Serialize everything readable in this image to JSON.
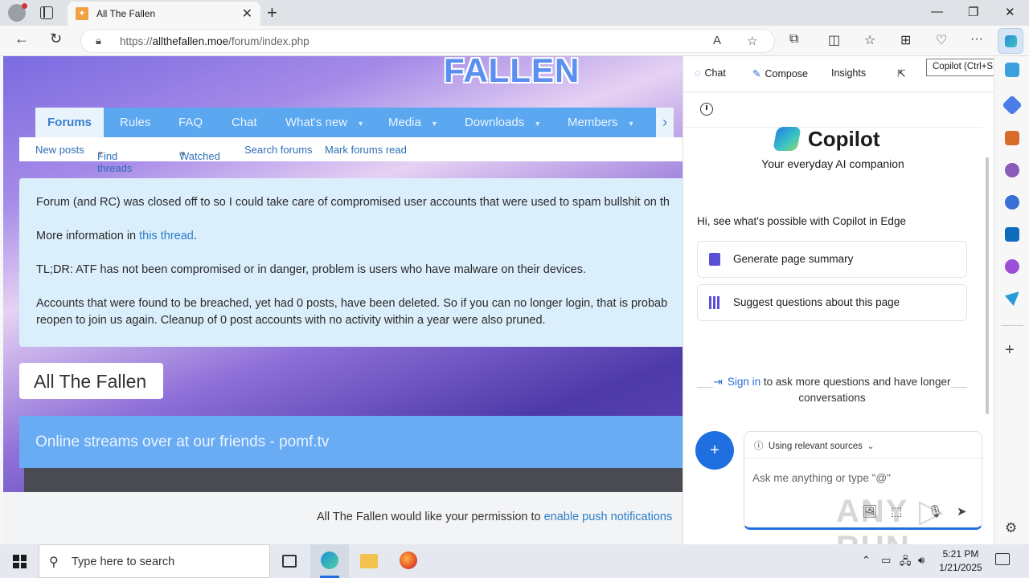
{
  "browser": {
    "tab_title": "All The Fallen",
    "new_tab": "+",
    "url_prefix": "https://",
    "url_domain": "allthefallen.moe",
    "url_path": "/forum/index.php",
    "tooltip": "Copilot (Ctrl+Shift+.)"
  },
  "site": {
    "logo_text": "FALLEN",
    "nav_tabs": [
      "Forums",
      "Rules",
      "FAQ",
      "Chat",
      "What's new",
      "Media",
      "Downloads",
      "Members"
    ],
    "sub_nav": [
      "New posts",
      "Find threads",
      "Watched",
      "Search forums",
      "Mark forums read"
    ],
    "notice": {
      "p1": "Forum (and RC) was closed off to so I could take care of compromised user accounts that were used to spam bullshit on th",
      "p2_before": "More information in ",
      "p2_link": "this thread",
      "p2_after": ".",
      "p3": "TL;DR: ATF has not been compromised or in danger, problem is users who have malware on their devices.",
      "p4_line1": "Accounts that were found to be breached, yet had 0 posts, have been deleted. So if you can no longer login, that is probab",
      "p4_line2": "reopen to join us again. Cleanup of 0 post accounts with no activity within a year were also pruned."
    },
    "forum_title": "All The Fallen",
    "stream_banner": "Online streams over at our friends - pomf.tv",
    "push_text": "All The Fallen would like your permission to ",
    "push_link": "enable push notifications"
  },
  "copilot": {
    "tabs": [
      "Chat",
      "Compose",
      "Insights"
    ],
    "brand": "Copilot",
    "tagline": "Your everyday AI companion",
    "intro": "Hi, see what's possible with Copilot in Edge",
    "cards": [
      "Generate page summary",
      "Suggest questions about this page"
    ],
    "signin_link": "Sign in",
    "signin_rest": " to ask more questions and have longer conversations",
    "sources": "Using relevant sources",
    "input_placeholder": "Ask me anything or type \"@\""
  },
  "taskbar": {
    "search_placeholder": "Type here to search",
    "time": "5:21 PM",
    "date": "1/21/2025"
  },
  "watermark": "ANY RUN",
  "colors": {
    "accent": "#1f6fe0",
    "site_nav": "#5ba7f0",
    "notice_bg": "#dbeefc"
  }
}
